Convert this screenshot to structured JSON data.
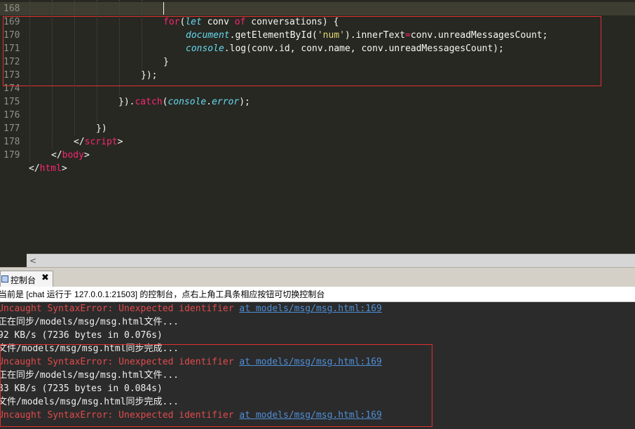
{
  "editor": {
    "lines": [
      {
        "number": "168",
        "tokens": []
      },
      {
        "number": "169",
        "tokens": [
          {
            "t": "for",
            "c": "kw"
          },
          {
            "t": "(",
            "c": "tx"
          },
          {
            "t": "let",
            "c": "st"
          },
          {
            "t": " conv ",
            "c": "tx"
          },
          {
            "t": "of",
            "c": "kw"
          },
          {
            "t": " conversations) {",
            "c": "tx"
          }
        ]
      },
      {
        "number": "170",
        "tokens": [
          {
            "t": "document",
            "c": "st"
          },
          {
            "t": ".getElementById(",
            "c": "tx"
          },
          {
            "t": "'num'",
            "c": "str"
          },
          {
            "t": ").innerText",
            "c": "tx"
          },
          {
            "t": "=",
            "c": "kw"
          },
          {
            "t": "conv.unreadMessagesCount;",
            "c": "tx"
          }
        ]
      },
      {
        "number": "171",
        "tokens": [
          {
            "t": "console",
            "c": "st"
          },
          {
            "t": ".log(conv.id, conv.name, conv.unreadMessagesCount);",
            "c": "tx"
          }
        ]
      },
      {
        "number": "172",
        "tokens": [
          {
            "t": "}",
            "c": "tx"
          }
        ]
      },
      {
        "number": "173",
        "tokens": [
          {
            "t": "});",
            "c": "tx"
          }
        ]
      },
      {
        "number": "174",
        "tokens": []
      },
      {
        "number": "175",
        "tokens": [
          {
            "t": "}).",
            "c": "tx"
          },
          {
            "t": "catch",
            "c": "kw"
          },
          {
            "t": "(",
            "c": "tx"
          },
          {
            "t": "console",
            "c": "st"
          },
          {
            "t": ".",
            "c": "tx"
          },
          {
            "t": "error",
            "c": "st"
          },
          {
            "t": ");",
            "c": "tx"
          }
        ]
      },
      {
        "number": "176",
        "tokens": []
      },
      {
        "number": "177",
        "tokens": [
          {
            "t": "})",
            "c": "tx"
          }
        ]
      },
      {
        "number": "178",
        "tokens": [
          {
            "t": "</",
            "c": "tx"
          },
          {
            "t": "script",
            "c": "tag"
          },
          {
            "t": ">",
            "c": "tx"
          }
        ]
      },
      {
        "number": "179",
        "tokens": [
          {
            "t": "</",
            "c": "tx"
          },
          {
            "t": "body",
            "c": "tag"
          },
          {
            "t": ">",
            "c": "tx"
          }
        ]
      },
      {
        "number": "",
        "tokens": [
          {
            "t": "</",
            "c": "tx"
          },
          {
            "t": "html",
            "c": "tag"
          },
          {
            "t": ">",
            "c": "tx"
          }
        ]
      }
    ]
  },
  "scrollbar": {
    "left_arrow": "<"
  },
  "console": {
    "tab_label": "控制台",
    "tab_close": "✖",
    "info": "当前是 [chat 运行于 127.0.0.1:21503] 的控制台，点右上角工具条相应按钮可切换控制台",
    "lines": [
      {
        "kind": "err",
        "text": "Uncaught SyntaxError: Unexpected identifier ",
        "link": "at models/msg/msg.html:169"
      },
      {
        "kind": "info",
        "text": "正在同步/models/msg/msg.html文件..."
      },
      {
        "kind": "info",
        "text": "92 KB/s (7236 bytes in 0.076s)"
      },
      {
        "kind": "info",
        "text": "文件/models/msg/msg.html同步完成..."
      },
      {
        "kind": "err",
        "text": "Uncaught SyntaxError: Unexpected identifier ",
        "link": "at models/msg/msg.html:169"
      },
      {
        "kind": "info",
        "text": "正在同步/models/msg/msg.html文件..."
      },
      {
        "kind": "info",
        "text": "83 KB/s (7235 bytes in 0.084s)"
      },
      {
        "kind": "info",
        "text": "文件/models/msg/msg.html同步完成..."
      },
      {
        "kind": "err",
        "text": "Uncaught SyntaxError: Unexpected identifier ",
        "link": "at models/msg/msg.html:169"
      }
    ]
  },
  "colors": {
    "editor_bg": "#272822",
    "keyword": "#f92672",
    "storage": "#66d9ef",
    "string": "#e6db74",
    "error_text": "#e24b4b",
    "link": "#4f8fd6",
    "highlight_box": "#e03030"
  }
}
